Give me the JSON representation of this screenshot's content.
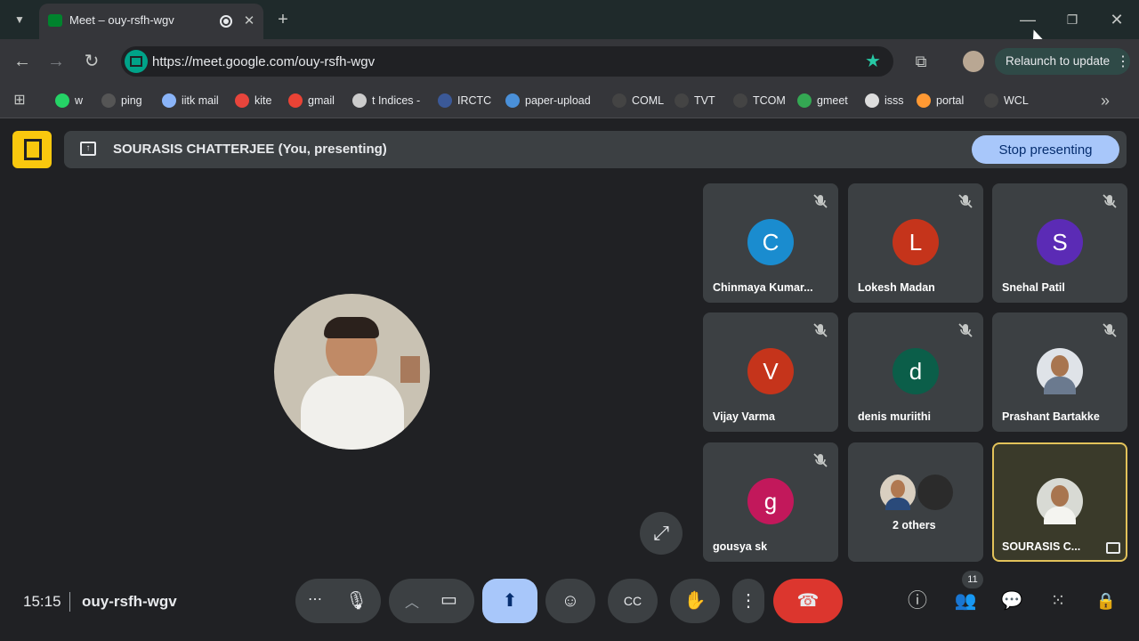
{
  "browser": {
    "tab_title": "Meet – ouy-rsfh-wgv",
    "url": "https://meet.google.com/ouy-rsfh-wgv",
    "relaunch_label": "Relaunch to update",
    "bookmarks": [
      {
        "label": "w",
        "color": "#25d366"
      },
      {
        "label": "ping",
        "color": "#555"
      },
      {
        "label": "iitk mail",
        "color": "#8ab4f8"
      },
      {
        "label": "kite",
        "color": "#e8453c"
      },
      {
        "label": "gmail",
        "color": "#ea4335"
      },
      {
        "label": "t Indices -",
        "color": "#ccc"
      },
      {
        "label": "IRCTC",
        "color": "#3b5998"
      },
      {
        "label": "paper-upload",
        "color": "#4a90d9"
      },
      {
        "label": "COML",
        "color": "#444"
      },
      {
        "label": "TVT",
        "color": "#444"
      },
      {
        "label": "TCOM",
        "color": "#444"
      },
      {
        "label": "gmeet",
        "color": "#34a853"
      },
      {
        "label": "isss",
        "color": "#ddd"
      },
      {
        "label": "portal",
        "color": "#ff9933"
      },
      {
        "label": "WCL",
        "color": "#444"
      }
    ]
  },
  "meet": {
    "presenting_label": "SOURASIS CHATTERJEE (You, presenting)",
    "stop_presenting": "Stop presenting",
    "participants": [
      {
        "name": "Chinmaya Kumar...",
        "initial": "C",
        "color": "#1a8ccf"
      },
      {
        "name": "Lokesh Madan",
        "initial": "L",
        "color": "#c5341b"
      },
      {
        "name": "Snehal Patil",
        "initial": "S",
        "color": "#5b2bb5"
      },
      {
        "name": "Vijay Varma",
        "initial": "V",
        "color": "#c5341b"
      },
      {
        "name": "denis muriithi",
        "initial": "d",
        "color": "#0b5e49"
      },
      {
        "name": "Prashant Bartakke",
        "initial": "",
        "color": "#dfe3e8"
      },
      {
        "name": "gousya sk",
        "initial": "g",
        "color": "#c2185b"
      },
      {
        "name": "2 others",
        "initial": "",
        "color": "#3c4043"
      },
      {
        "name": "SOURASIS C...",
        "initial": "",
        "color": "#d8dad4"
      }
    ],
    "time": "15:15",
    "meeting_code": "ouy-rsfh-wgv",
    "people_count": "11"
  }
}
